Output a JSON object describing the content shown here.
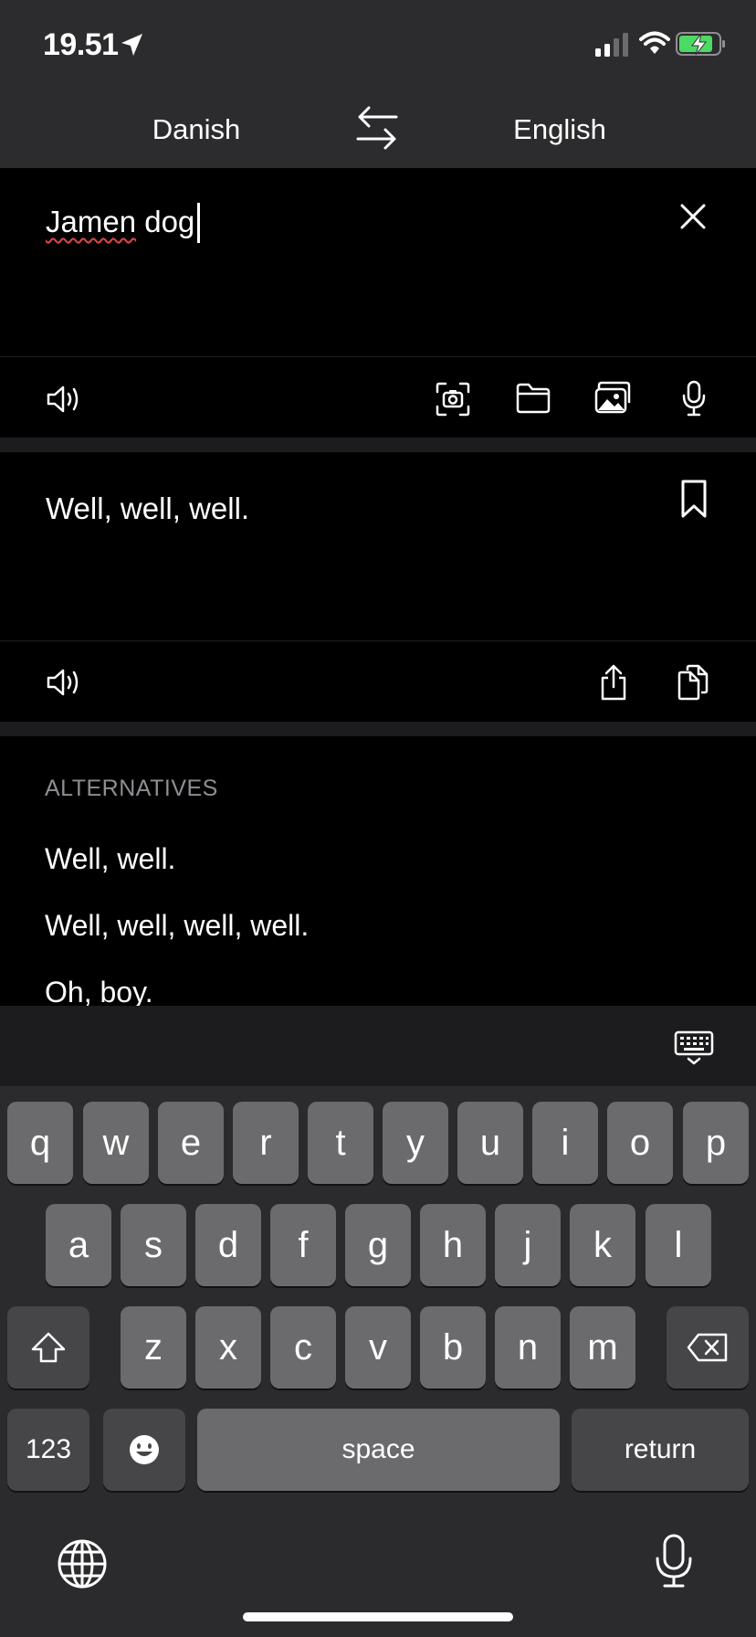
{
  "status_bar": {
    "time": "19.51",
    "icons": [
      "location-arrow-icon",
      "cellular-signal-icon",
      "wifi-icon",
      "battery-charging-icon"
    ],
    "battery_color": "#4cd964"
  },
  "language_bar": {
    "source_language": "Danish",
    "target_language": "English",
    "swap_icon": "swap-arrows-icon"
  },
  "source": {
    "text_underlined": "Jamen",
    "text_rest": " dog",
    "spellcheck_color": "#e04848",
    "actions": [
      "speaker-icon",
      "camera-scan-icon",
      "folder-icon",
      "photos-icon",
      "microphone-icon"
    ]
  },
  "result": {
    "text": "Well, well, well.",
    "actions": [
      "speaker-icon",
      "share-icon",
      "copy-icon",
      "bookmark-icon"
    ]
  },
  "alternatives": {
    "heading": "ALTERNATIVES",
    "items": [
      "Well, well.",
      "Well, well, well, well.",
      "Oh, boy."
    ]
  },
  "keyboard": {
    "row1": [
      "q",
      "w",
      "e",
      "r",
      "t",
      "y",
      "u",
      "i",
      "o",
      "p"
    ],
    "row2": [
      "a",
      "s",
      "d",
      "f",
      "g",
      "h",
      "j",
      "k",
      "l"
    ],
    "row3": [
      "z",
      "x",
      "c",
      "v",
      "b",
      "n",
      "m"
    ],
    "numbers_label": "123",
    "space_label": "space",
    "return_label": "return"
  },
  "colors": {
    "top_bar": "#2c2c2e",
    "panel": "#000000",
    "separator": "#1c1c1e",
    "muted_text": "#8e8e93",
    "key": "#6b6b6e",
    "key_dark": "#464649"
  }
}
